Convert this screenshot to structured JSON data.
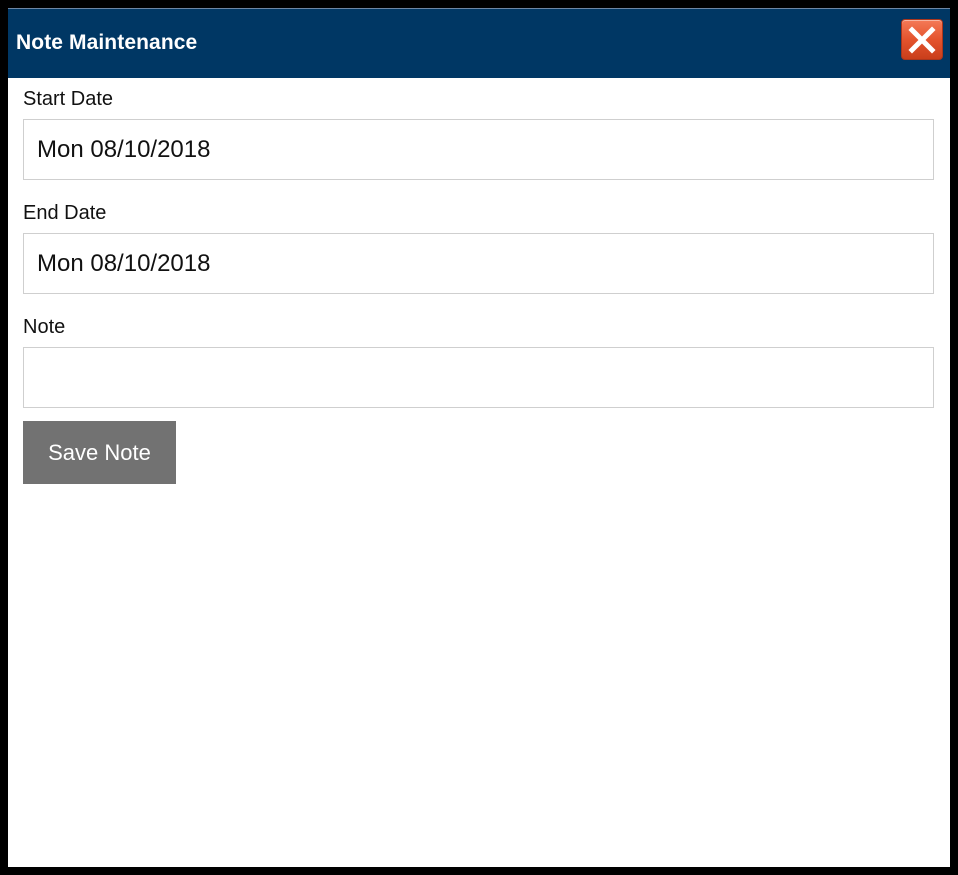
{
  "dialog": {
    "title": "Note Maintenance",
    "close_icon": "close-icon",
    "colors": {
      "titlebar": "#003764",
      "close_button": "#e4532d",
      "save_button": "#727272"
    }
  },
  "form": {
    "start_date": {
      "label": "Start Date",
      "value": "Mon 08/10/2018"
    },
    "end_date": {
      "label": "End Date",
      "value": "Mon 08/10/2018"
    },
    "note": {
      "label": "Note",
      "value": ""
    },
    "save_label": "Save Note"
  }
}
